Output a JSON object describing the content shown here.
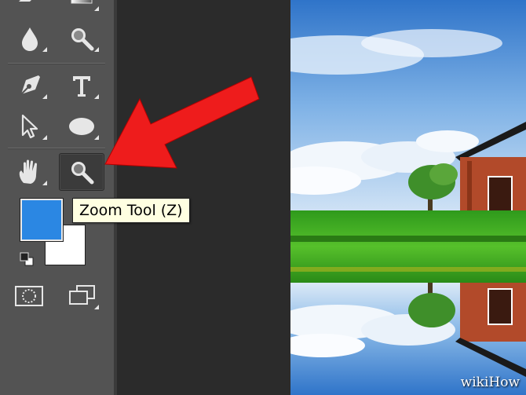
{
  "app": {
    "name": "Photoshop tool panel"
  },
  "tools": [
    {
      "name": "blur-tool",
      "icon": "drop-icon"
    },
    {
      "name": "zoom-tool-alt",
      "icon": "magnifier-icon"
    },
    {
      "name": "pen-tool",
      "icon": "pen-nib-icon"
    },
    {
      "name": "type-tool",
      "icon": "type-t-icon"
    },
    {
      "name": "path-selection-tool",
      "icon": "arrow-pointer-icon"
    },
    {
      "name": "ellipse-tool",
      "icon": "ellipse-icon"
    },
    {
      "name": "hand-tool",
      "icon": "hand-icon"
    },
    {
      "name": "zoom-tool",
      "icon": "magnifier-icon",
      "selected": true
    }
  ],
  "tooltip": {
    "text": "Zoom Tool (Z)"
  },
  "colors": {
    "foreground": "#2b87e3",
    "background": "#ffffff",
    "arrow": "#ee1c1c"
  },
  "watermark": {
    "text": "wikiHow"
  }
}
